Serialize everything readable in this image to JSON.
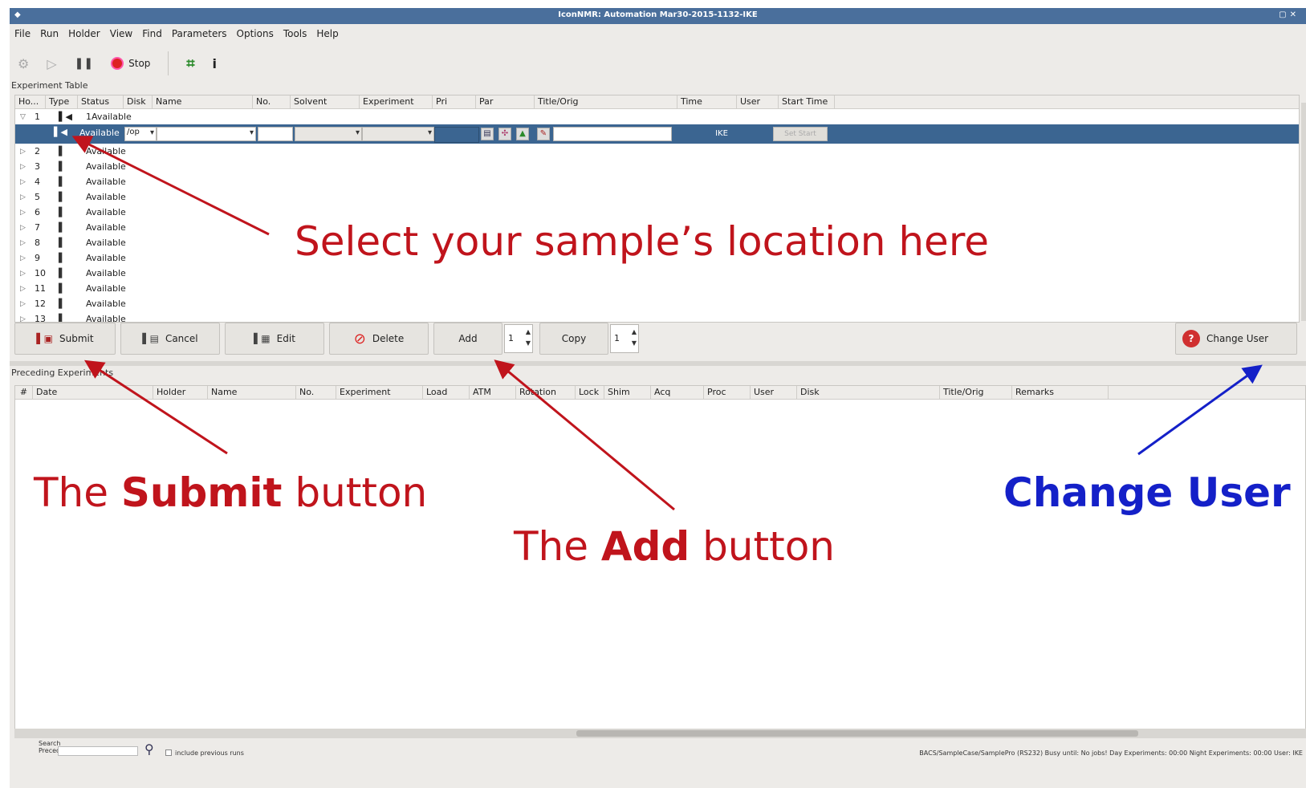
{
  "window": {
    "title": "IconNMR: Automation Mar30-2015-1132-IKE"
  },
  "menu": [
    "File",
    "Run",
    "Holder",
    "View",
    "Find",
    "Parameters",
    "Options",
    "Tools",
    "Help"
  ],
  "toolbar": {
    "stop_label": "Stop"
  },
  "experiment_table": {
    "label": "Experiment Table",
    "columns": [
      "Ho...",
      "Type",
      "Status",
      "Disk",
      "Name",
      "No.",
      "Solvent",
      "Experiment",
      "Pri",
      "Par",
      "Title/Orig",
      "Time",
      "User",
      "Start Time"
    ],
    "group_row": {
      "num": "1",
      "status": "1Available"
    },
    "edit_row": {
      "status": "Available",
      "disk": "/op",
      "user": "IKE",
      "set_start": "Set Start"
    },
    "rows": [
      {
        "num": "2",
        "status": "Available"
      },
      {
        "num": "3",
        "status": "Available"
      },
      {
        "num": "4",
        "status": "Available"
      },
      {
        "num": "5",
        "status": "Available"
      },
      {
        "num": "6",
        "status": "Available"
      },
      {
        "num": "7",
        "status": "Available"
      },
      {
        "num": "8",
        "status": "Available"
      },
      {
        "num": "9",
        "status": "Available"
      },
      {
        "num": "10",
        "status": "Available"
      },
      {
        "num": "11",
        "status": "Available"
      },
      {
        "num": "12",
        "status": "Available"
      },
      {
        "num": "13",
        "status": "Available"
      }
    ]
  },
  "buttons": {
    "submit": "Submit",
    "cancel": "Cancel",
    "edit": "Edit",
    "delete": "Delete",
    "add": "Add",
    "add_count": "1",
    "copy": "Copy",
    "copy_count": "1",
    "change_user": "Change User"
  },
  "preceding_table": {
    "label": "Preceding Experiments",
    "columns": [
      "#",
      "Date",
      "Holder",
      "Name",
      "No.",
      "Experiment",
      "Load",
      "ATM",
      "Rotation",
      "Lock",
      "Shim",
      "Acq",
      "Proc",
      "User",
      "Disk",
      "Title/Orig",
      "Remarks"
    ]
  },
  "statusbar": {
    "search_label_1": "Search",
    "search_label_2": "Preceding",
    "include_previous": "include previous runs",
    "right_text": "BACS/SampleCase/SamplePro (RS232)   Busy until:   No jobs!   Day Experiments: 00:00   Night Experiments: 00:00   User:   IKE"
  },
  "annotations": {
    "location": "Select your sample’s location here",
    "submit_prefix": "The ",
    "submit_bold": "Submit",
    "submit_suffix": " button",
    "add_prefix": "The ",
    "add_bold": "Add",
    "add_suffix": " button",
    "change_user": "Change User"
  },
  "colors": {
    "annotation_red": "#c0141c",
    "annotation_blue": "#1420c8",
    "selection_blue": "#3b6591",
    "titlebar": "#4a6f9c"
  }
}
